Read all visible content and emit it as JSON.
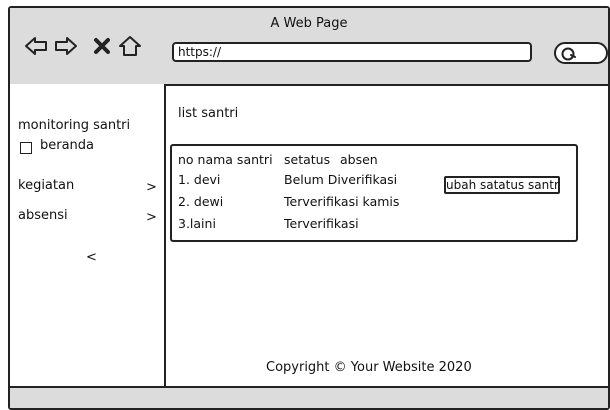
{
  "window": {
    "title": "A Web Page"
  },
  "toolbar": {
    "back_icon": "back-arrow-icon",
    "forward_icon": "forward-arrow-icon",
    "close_icon": "close-icon",
    "home_icon": "home-icon",
    "url": "https://",
    "search_icon": "search-icon"
  },
  "sidebar": {
    "brand": "monitoring santri",
    "items": [
      {
        "label": "beranda",
        "icon": "checkbox-icon"
      },
      {
        "label": "kegiatan",
        "chevron": ">"
      },
      {
        "label": "absensi",
        "chevron": ">"
      }
    ],
    "collapse": "<"
  },
  "main": {
    "title": "list santri",
    "table": {
      "headers": [
        "no nama santri",
        "setatus",
        "absen"
      ],
      "rows": [
        [
          "1. devi",
          "Belum Diverifikasi"
        ],
        [
          "2. dewi",
          "Terverifikasi kamis"
        ],
        [
          "3.laini",
          "Terverifikasi"
        ]
      ],
      "action_label": "ubah satatus santri"
    }
  },
  "footer": {
    "copyright": "Copyright © Your Website 2020"
  }
}
